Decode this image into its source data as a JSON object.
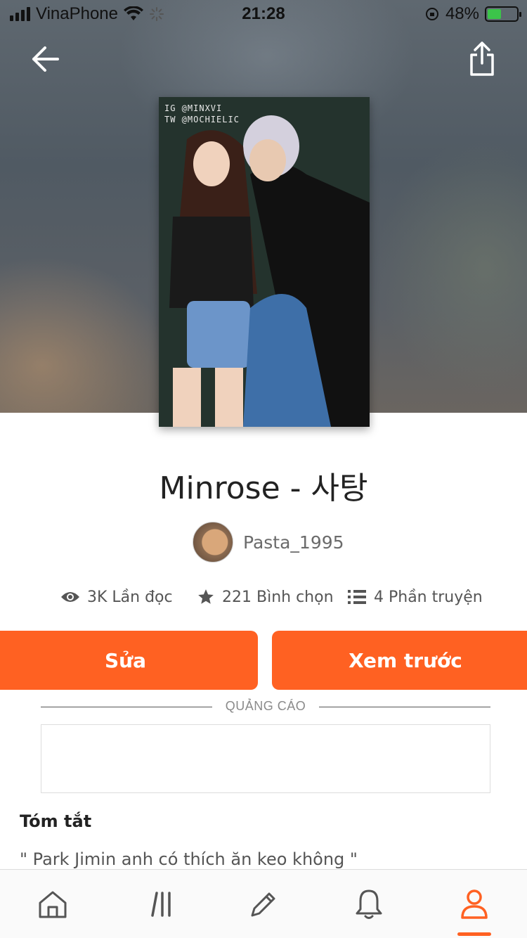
{
  "status_bar": {
    "carrier": "VinaPhone",
    "time": "21:28",
    "battery": "48%",
    "battery_level": 0.48
  },
  "story": {
    "cover_caption_line1": "IG @MINXVI",
    "cover_caption_line2": "TW @MOCHIELIC",
    "title": "Minrose - 사탕",
    "author": "Pasta_1995",
    "reads": "3K Lần đọc",
    "votes": "221 Bình chọn",
    "parts": "4 Phần truyện"
  },
  "actions": {
    "edit_label": "Sửa",
    "preview_label": "Xem trước"
  },
  "ad": {
    "label": "QUẢNG CÁO"
  },
  "summary": {
    "heading": "Tóm tắt",
    "text": "\" Park Jimin anh có thích ăn keo không \""
  },
  "icons": {
    "back": "arrow-left-icon",
    "share": "share-icon",
    "reads": "eye-icon",
    "votes": "star-icon",
    "parts": "list-icon",
    "nav_home": "home-icon",
    "nav_library": "library-icon",
    "nav_write": "pencil-icon",
    "nav_notifications": "bell-icon",
    "nav_profile": "profile-icon"
  },
  "colors": {
    "accent": "#ff6122",
    "text_dark": "#222222",
    "text_muted": "#555555"
  }
}
